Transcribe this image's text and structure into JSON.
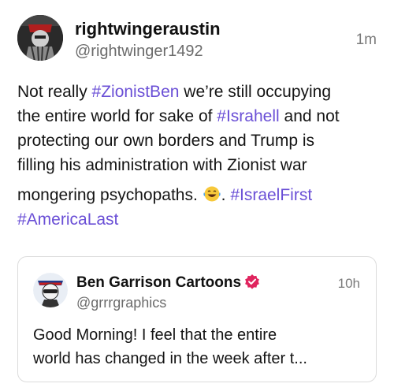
{
  "post": {
    "display_name": "rightwingeraustin",
    "handle": "@rightwinger1492",
    "timestamp": "1m",
    "lines": [
      [
        {
          "t": "Not really "
        },
        {
          "t": "#ZionistBen",
          "tag": true
        },
        {
          "t": " we’re still occupying"
        }
      ],
      [
        {
          "t": "the entire world for sake of "
        },
        {
          "t": "#Israhell",
          "tag": true
        },
        {
          "t": " and not"
        }
      ],
      [
        {
          "t": "protecting our own borders and Trump is"
        }
      ],
      [
        {
          "t": "filling his administration with Zionist war"
        }
      ],
      [
        {
          "t": "mongering psychopaths. "
        },
        {
          "emoji": "laughing-tears-emoji"
        },
        {
          "t": ". "
        },
        {
          "t": "#IsraelFirst",
          "tag": true
        }
      ],
      [
        {
          "t": "#AmericaLast",
          "tag": true
        }
      ]
    ]
  },
  "quote": {
    "display_name": "Ben Garrison Cartoons",
    "handle": "@grrrgraphics",
    "timestamp": "10h",
    "lines": [
      "Good Morning! I feel that the entire",
      "world has changed in the week after t..."
    ]
  },
  "colors": {
    "hashtag": "#6a4fd6",
    "verified": "#e0245e",
    "muted_text": "#6b6b6b"
  }
}
